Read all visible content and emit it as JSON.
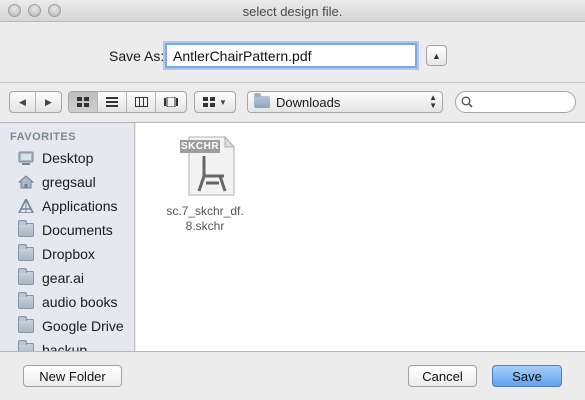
{
  "window": {
    "title": "select design file."
  },
  "save_as": {
    "label": "Save As:",
    "value": "AntlerChairPattern.pdf"
  },
  "toolbar": {
    "location": "Downloads",
    "search_placeholder": ""
  },
  "sidebar": {
    "header": "FAVORITES",
    "items": [
      {
        "label": "Desktop",
        "icon": "desktop-icon"
      },
      {
        "label": "gregsaul",
        "icon": "home-icon"
      },
      {
        "label": "Applications",
        "icon": "applications-icon"
      },
      {
        "label": "Documents",
        "icon": "folder-icon"
      },
      {
        "label": "Dropbox",
        "icon": "folder-icon"
      },
      {
        "label": "gear.ai",
        "icon": "folder-icon"
      },
      {
        "label": "audio books",
        "icon": "folder-icon"
      },
      {
        "label": "Google Drive",
        "icon": "folder-icon"
      },
      {
        "label": "backup",
        "icon": "folder-icon"
      }
    ]
  },
  "files": [
    {
      "badge": "SKCHR",
      "name_line1": "sc.7_skchr_df.",
      "name_line2": "8.skchr"
    }
  ],
  "buttons": {
    "new_folder": "New Folder",
    "cancel": "Cancel",
    "save": "Save"
  }
}
